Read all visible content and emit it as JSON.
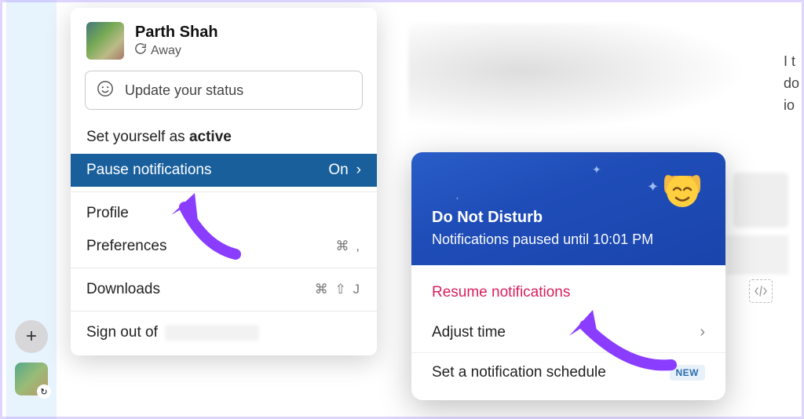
{
  "user": {
    "name": "Parth Shah",
    "presence": "Away"
  },
  "status_input": {
    "placeholder": "Update your status"
  },
  "menu": {
    "set_active_prefix": "Set yourself as ",
    "set_active_word": "active",
    "pause_notifications": "Pause notifications",
    "pause_state": "On",
    "profile": "Profile",
    "preferences": "Preferences",
    "preferences_shortcut": "⌘ ,",
    "downloads": "Downloads",
    "downloads_shortcut": "⌘ ⇧ J",
    "sign_out_prefix": "Sign out of"
  },
  "dnd": {
    "title": "Do Not Disturb",
    "subtitle": "Notifications paused until 10:01 PM",
    "resume": "Resume notifications",
    "adjust": "Adjust time",
    "schedule": "Set a notification schedule",
    "new_badge": "NEW"
  },
  "bg": {
    "t1": "I t",
    "t2": "do",
    "t3": "io"
  },
  "colors": {
    "highlight": "#195f9c",
    "accent_pink": "#d91f5c",
    "dnd_gradient_start": "#2a5dc7"
  }
}
